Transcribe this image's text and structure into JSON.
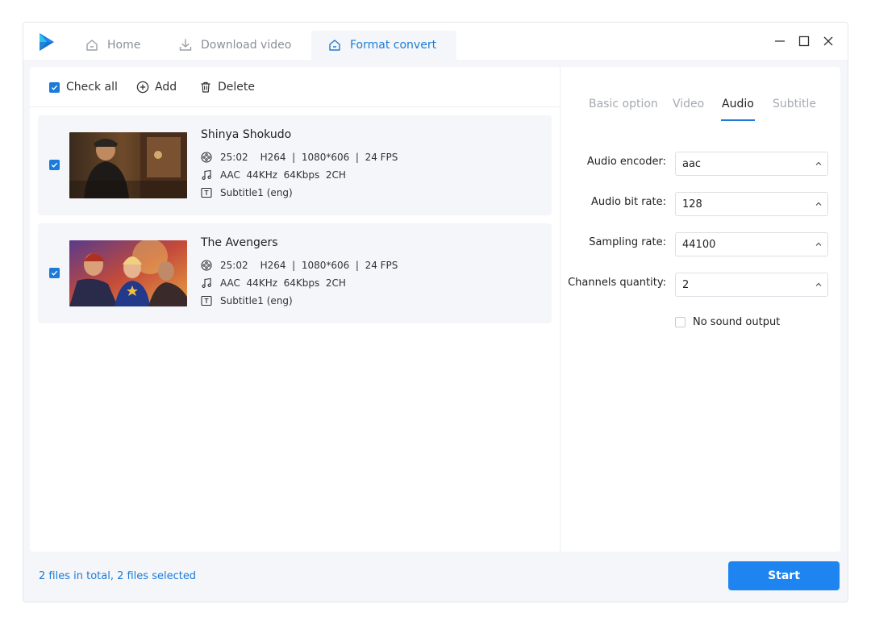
{
  "tabs": {
    "home": "Home",
    "download": "Download video",
    "format": "Format convert"
  },
  "toolbar": {
    "check_all": "Check all",
    "add": "Add",
    "delete": "Delete"
  },
  "files": [
    {
      "title": "Shinya Shokudo",
      "duration": "25:02",
      "video_info": "H264  |  1080*606  |  24 FPS",
      "audio_info": "AAC  44KHz  64Kbps  2CH",
      "subtitle": "Subtitle1 (eng)",
      "checked": true
    },
    {
      "title": "The Avengers",
      "duration": "25:02",
      "video_info": "H264  |  1080*606  |  24 FPS",
      "audio_info": "AAC  44KHz  64Kbps  2CH",
      "subtitle": "Subtitle1 (eng)",
      "checked": true
    }
  ],
  "settings_tabs": {
    "basic": "Basic option",
    "video": "Video",
    "audio": "Audio",
    "subtitle": "Subtitle",
    "active": "Audio"
  },
  "audio": {
    "encoder_label": "Audio encoder:",
    "encoder_value": "aac",
    "bitrate_label": "Audio bit rate:",
    "bitrate_value": "128",
    "sampling_label": "Sampling rate:",
    "sampling_value": "44100",
    "channels_label": "Channels quantity:",
    "channels_value": "2",
    "no_sound_label": "No sound output",
    "no_sound_checked": false
  },
  "footer": {
    "status": "2 files in total, 2 files selected",
    "start": "Start"
  },
  "colors": {
    "accent": "#1c7bd8",
    "button": "#1e85f0"
  }
}
